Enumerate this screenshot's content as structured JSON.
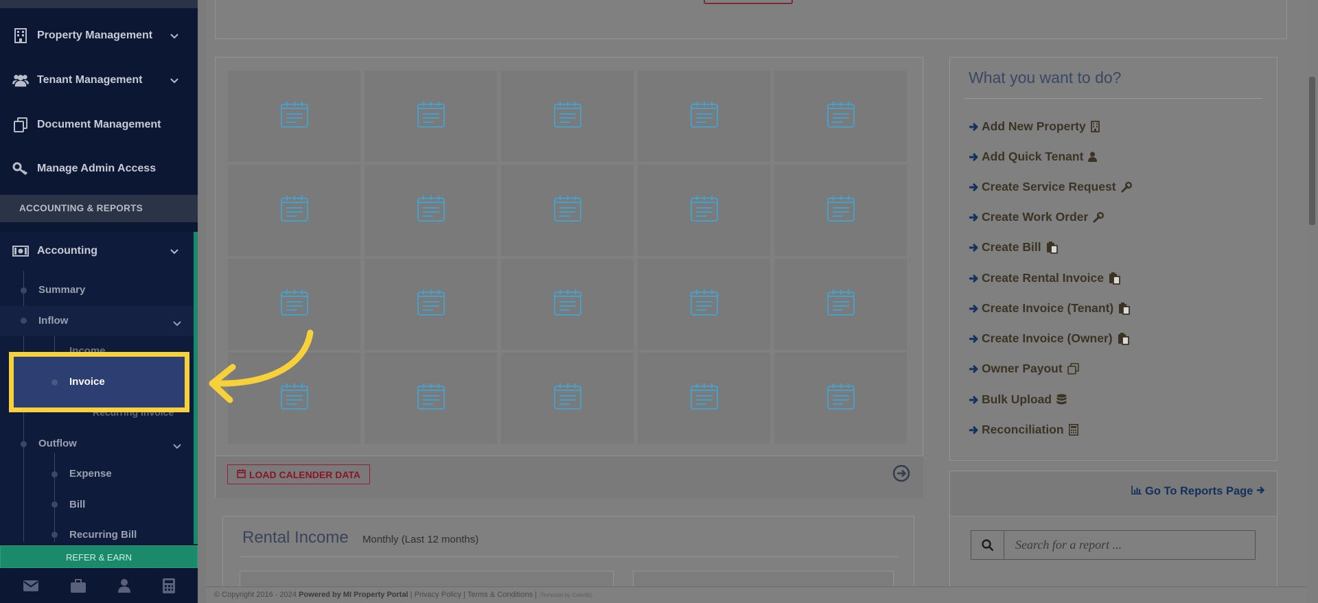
{
  "sidebar": {
    "items": [
      {
        "label": "Property Management",
        "icon": "building-icon"
      },
      {
        "label": "Tenant Management",
        "icon": "users-icon"
      },
      {
        "label": "Document Management",
        "icon": "documents-icon"
      },
      {
        "label": "Manage Admin Access",
        "icon": "key-icon"
      }
    ],
    "section_heading": "ACCOUNTING & REPORTS",
    "accounting": {
      "label": "Accounting",
      "sub": {
        "summary": "Summary",
        "inflow": "Inflow",
        "income": "Income",
        "invoice": "Invoice",
        "recurring_invoice": "Recurring Invoice",
        "outflow": "Outflow",
        "expense": "Expense",
        "bill": "Bill",
        "recurring_bill": "Recurring Bill"
      }
    },
    "refer_label": "REFER & EARN",
    "bottom_icons": [
      "envelope-icon",
      "briefcase-icon",
      "user-icon",
      "calculator-icon"
    ]
  },
  "calendar": {
    "load_button": "LOAD CALENDER DATA",
    "rows": 4,
    "cols": 5
  },
  "quick_actions": {
    "title": "What you want to do?",
    "items": [
      {
        "label": "Add New Property",
        "icon": "building-icon"
      },
      {
        "label": "Add Quick Tenant",
        "icon": "user-icon"
      },
      {
        "label": "Create Service Request",
        "icon": "wrench-icon"
      },
      {
        "label": "Create Work Order",
        "icon": "wrench-icon"
      },
      {
        "label": "Create Bill",
        "icon": "paste-icon"
      },
      {
        "label": "Create Rental Invoice",
        "icon": "paste-icon"
      },
      {
        "label": "Create Invoice (Tenant)",
        "icon": "paste-icon"
      },
      {
        "label": "Create Invoice (Owner)",
        "icon": "paste-icon"
      },
      {
        "label": "Owner Payout",
        "icon": "copy-icon"
      },
      {
        "label": "Bulk Upload",
        "icon": "database-icon"
      },
      {
        "label": "Reconciliation",
        "icon": "calculator-icon"
      }
    ]
  },
  "reports": {
    "link_label": "Go To Reports Page",
    "search_placeholder": "Search for a report ..."
  },
  "rental_income": {
    "title": "Rental Income",
    "subtitle": "Monthly (Last 12 months)"
  },
  "footer": {
    "copyright": "© Copyright 2016 - 2024",
    "powered": "Powered by MI Property Portal",
    "privacy": "Privacy Policy",
    "terms": "Terms & Conditions",
    "template": "(Template by Colorlib)"
  },
  "colors": {
    "sidebar_bg": "#0c1734",
    "highlight": "#f6d13a",
    "refer_green": "#1a8a6a",
    "accent_red": "#9a1d31"
  }
}
